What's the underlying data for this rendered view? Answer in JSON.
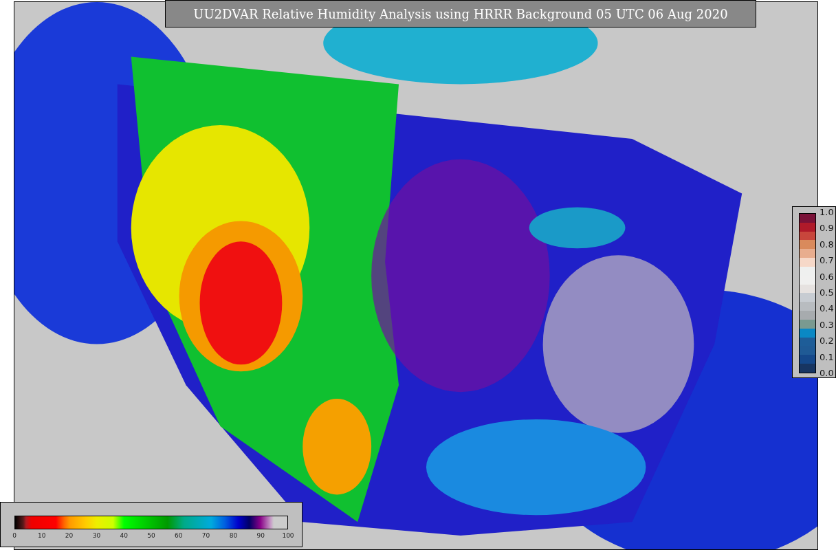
{
  "title": "UU2DVAR Relative Humidity Analysis using HRRR Background 05 UTC 06 Aug 2020",
  "weight_colorbar": {
    "ticks": [
      "1.0",
      "0.9",
      "0.8",
      "0.7",
      "0.6",
      "0.5",
      "0.4",
      "0.3",
      "0.2",
      "0.1",
      "0.0"
    ]
  },
  "humidity_colorbar": {
    "ticks": [
      "0",
      "10",
      "20",
      "30",
      "40",
      "50",
      "60",
      "70",
      "80",
      "90",
      "100"
    ]
  }
}
